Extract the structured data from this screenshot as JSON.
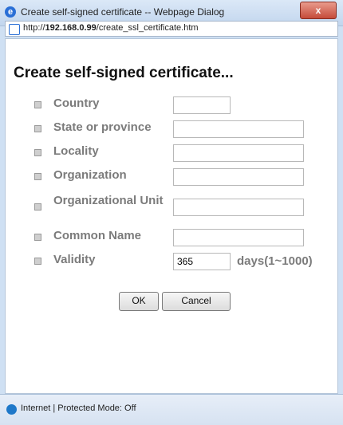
{
  "window": {
    "title": "Create self-signed certificate -- Webpage Dialog",
    "close_label": "x"
  },
  "address": {
    "prefix": "http://",
    "host": "192.168.0.99",
    "path": "/create_ssl_certificate.htm"
  },
  "page": {
    "heading": "Create self-signed certificate..."
  },
  "form": {
    "fields": [
      {
        "label": "Country",
        "value": ""
      },
      {
        "label": "State or province",
        "value": ""
      },
      {
        "label": "Locality",
        "value": ""
      },
      {
        "label": "Organization",
        "value": ""
      },
      {
        "label": "Organizational Unit",
        "value": ""
      },
      {
        "label": "Common Name",
        "value": ""
      },
      {
        "label": "Validity",
        "value": "365",
        "unit": "days(1~1000)"
      }
    ]
  },
  "buttons": {
    "ok": "OK",
    "cancel": "Cancel"
  },
  "status": {
    "text": "Internet | Protected Mode: Off"
  }
}
